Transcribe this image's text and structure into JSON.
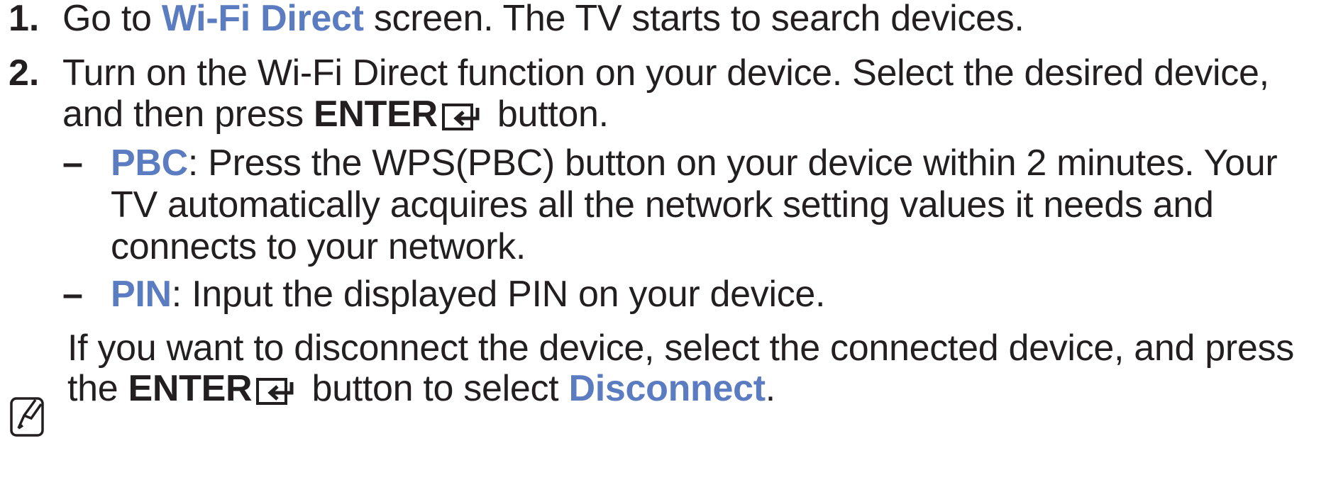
{
  "steps": [
    {
      "number": "1.",
      "lines": [
        {
          "pre": "Go to ",
          "link": "Wi-Fi Direct",
          "post": " screen. The TV starts to search devices."
        }
      ]
    },
    {
      "number": "2.",
      "line1": "Turn on the Wi-Fi Direct function on your device. Select the desired device,",
      "line2_pre": "and then press ",
      "line2_key": "ENTER",
      "line2_post": " button."
    }
  ],
  "options": [
    {
      "dash": "–",
      "term": "PBC",
      "line1": ": Press the WPS(PBC) button on your device within 2 minutes. Your",
      "line2": "TV automatically acquires all the network setting values it needs and",
      "line3": "connects to your network."
    },
    {
      "dash": "–",
      "term": "PIN",
      "line1": ": Input the displayed PIN on your device."
    }
  ],
  "note": {
    "icon": "note-pencil-icon",
    "line1": "If you want to disconnect the device, select the connected device, and press",
    "line2_pre": "the ",
    "line2_key": "ENTER",
    "line2_mid": " button to select ",
    "line2_link": "Disconnect",
    "line2_post": "."
  },
  "colors": {
    "accent": "#5b7cc0",
    "text": "#231f20"
  },
  "icons": {
    "enter": "enter-key-icon"
  }
}
